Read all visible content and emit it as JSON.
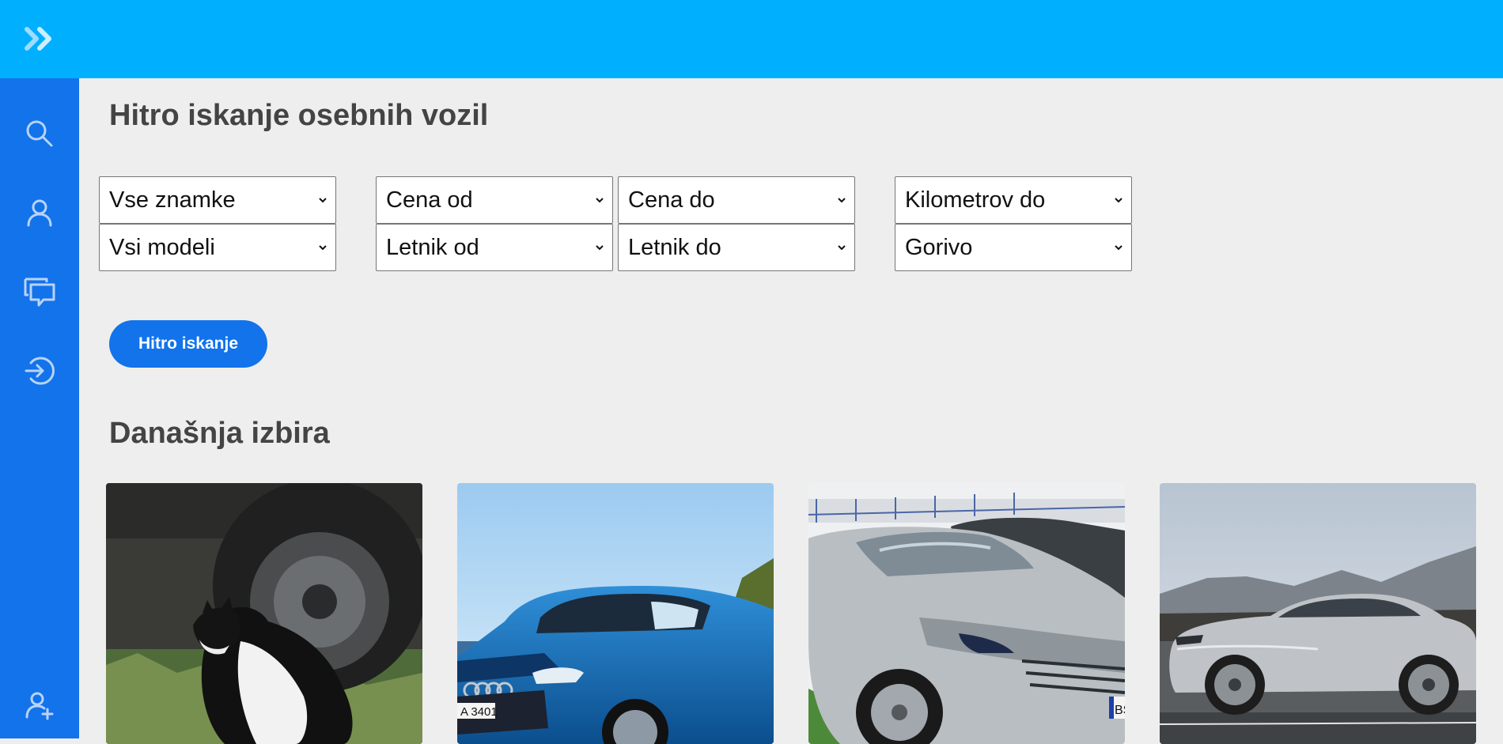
{
  "colors": {
    "topbar": "#00b0ff",
    "sidebar": "#1273eb",
    "background": "#eeeeee",
    "heading": "#444444",
    "button": "#1273eb"
  },
  "topbar": {
    "toggle_icon": "double-chevron-right-icon"
  },
  "sidebar": {
    "items": [
      {
        "icon": "search-icon"
      },
      {
        "icon": "user-icon"
      },
      {
        "icon": "messages-icon"
      },
      {
        "icon": "login-icon"
      },
      {
        "icon": "user-add-icon"
      }
    ]
  },
  "search": {
    "title": "Hitro iskanje osebnih vozil",
    "filters": {
      "brand": "Vse znamke",
      "model": "Vsi modeli",
      "price_from": "Cena od",
      "price_to": "Cena do",
      "year_from": "Letnik od",
      "year_to": "Letnik do",
      "km_to": "Kilometrov do",
      "fuel": "Gorivo"
    },
    "button_label": "Hitro iskanje"
  },
  "featured": {
    "title": "Današnja izbira",
    "cards": [
      {
        "plate": ""
      },
      {
        "plate": "A 3401"
      },
      {
        "plate": "BS"
      },
      {
        "plate": ""
      }
    ]
  }
}
